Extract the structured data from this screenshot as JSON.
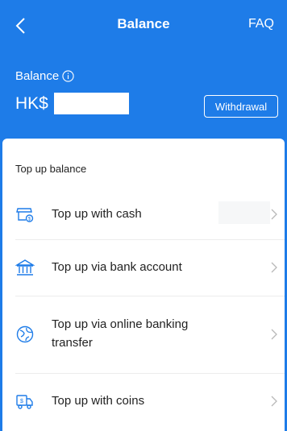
{
  "nav": {
    "title": "Balance",
    "faq_label": "FAQ"
  },
  "balance": {
    "label": "Balance",
    "currency": "HK$",
    "value_masked": true,
    "withdraw_label": "Withdrawal"
  },
  "topup": {
    "section_title": "Top up balance",
    "items": [
      {
        "label": "Top up with cash",
        "icon": "cash-store-icon"
      },
      {
        "label": "Top up via bank account",
        "icon": "bank-icon"
      },
      {
        "label": "Top up via online banking transfer",
        "icon": "globe-transfer-icon"
      },
      {
        "label": "Top up with coins",
        "icon": "coin-truck-icon"
      }
    ]
  },
  "colors": {
    "primary": "#1e7ce8",
    "icon_blue": "#1e7ce8",
    "text": "#222222",
    "divider": "#ececec"
  }
}
